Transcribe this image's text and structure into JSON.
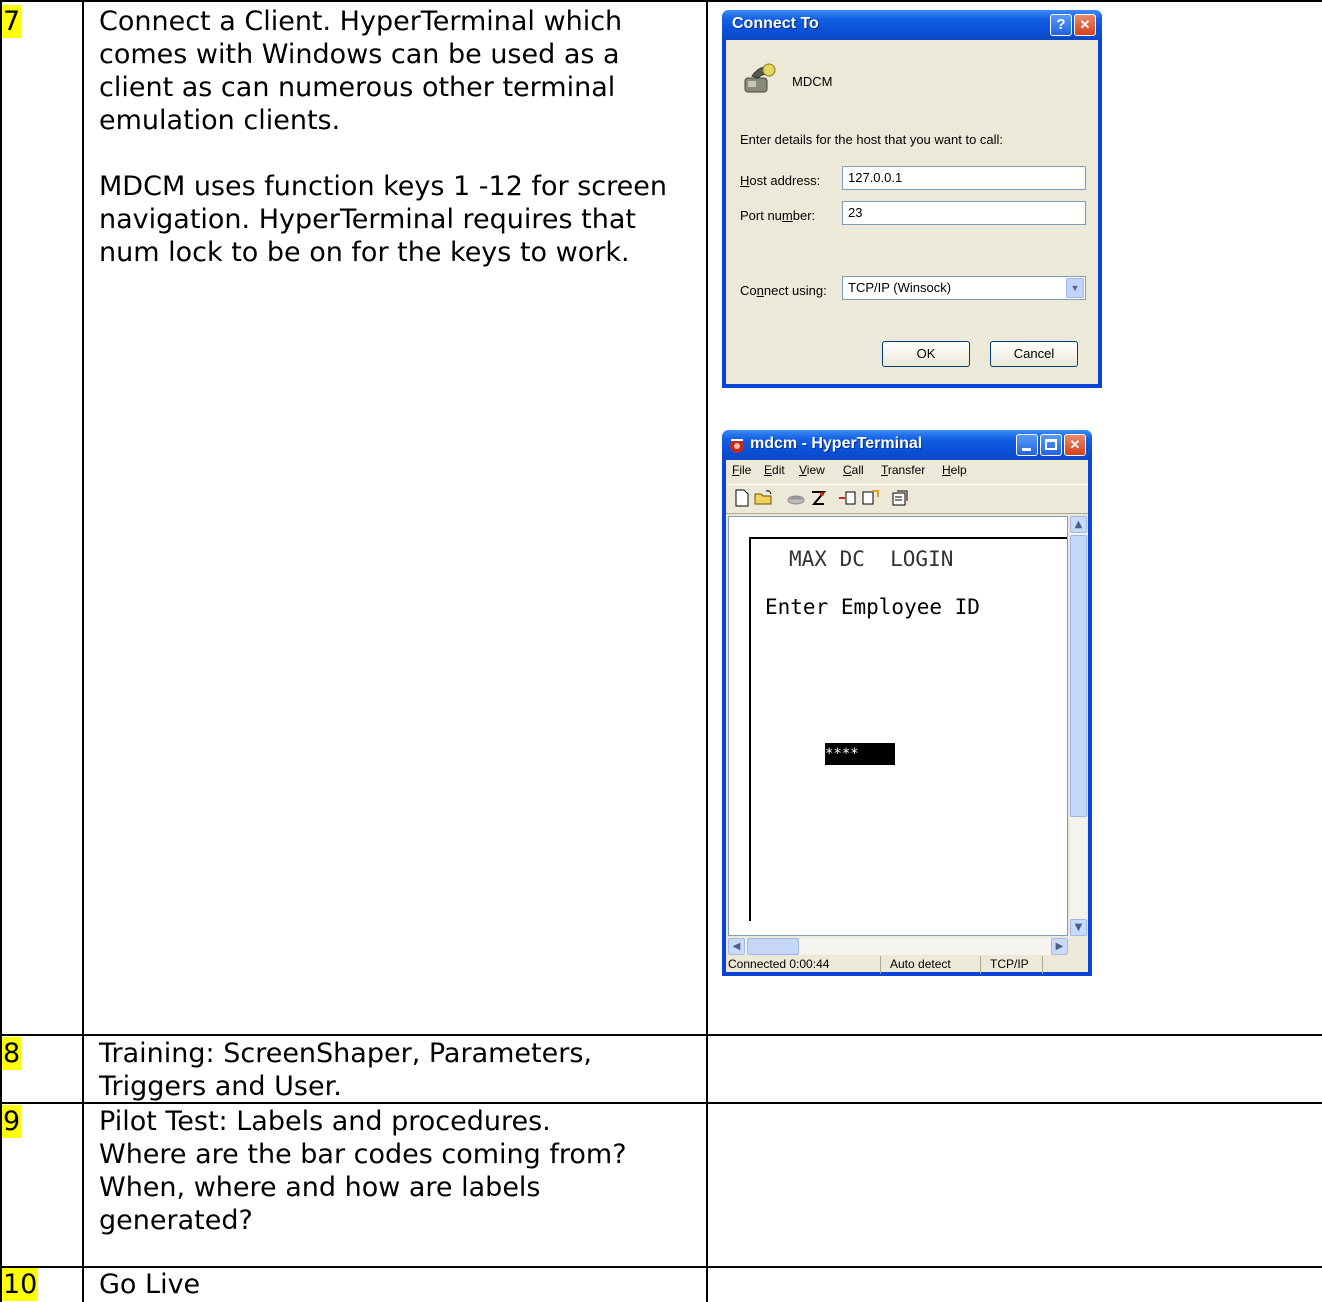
{
  "rows": [
    {
      "step": "7",
      "description": "Connect a Client. HyperTerminal which\ncomes with Windows can be used as a\nclient as can numerous other terminal\nemulation clients.\n\nMDCM uses function keys 1 -12 for screen\nnavigation. HyperTerminal requires that\nnum lock to be on for the keys to work."
    },
    {
      "step": "8",
      "description": "Training: ScreenShaper, Parameters,\nTriggers and User."
    },
    {
      "step": "9",
      "description": "Pilot Test: Labels and procedures.\nWhere are the bar codes coming from?\nWhen, where and how are labels\ngenerated?"
    },
    {
      "step": "10",
      "description": "Go Live"
    }
  ],
  "connect_dialog": {
    "title": "Connect To",
    "help_glyph": "?",
    "close_glyph": "✕",
    "connection_name": "MDCM",
    "prompt": "Enter details for the host that you want to call:",
    "host_label_key": "H",
    "host_label_rest": "ost address:",
    "host_value": "127.0.0.1",
    "port_label_pre": "Port nu",
    "port_label_key": "m",
    "port_label_post": "ber:",
    "port_value": "23",
    "connect_label_pre": "Co",
    "connect_label_key": "n",
    "connect_label_post": "nect using:",
    "connect_value": "TCP/IP (Winsock)",
    "ok_label": "OK",
    "cancel_label": "Cancel"
  },
  "hyperterminal": {
    "title": "mdcm - HyperTerminal",
    "menu": [
      {
        "key": "F",
        "rest": "ile"
      },
      {
        "key": "E",
        "rest": "dit"
      },
      {
        "key": "V",
        "rest": "iew"
      },
      {
        "key": "C",
        "rest": "all"
      },
      {
        "key": "T",
        "rest": "ransfer"
      },
      {
        "key": "H",
        "rest": "elp"
      }
    ],
    "toolbar_icons": [
      "new-icon",
      "open-icon",
      "disconnect-icon",
      "dial-icon",
      "send-icon",
      "receive-icon",
      "properties-icon"
    ],
    "screen_line_1": "MAX DC  LOGIN",
    "screen_line_2": "Enter Employee ID",
    "masked_input": "****",
    "status_connected": "Connected 0:00:44",
    "status_detect": "Auto detect",
    "status_protocol": "TCP/IP",
    "colors": {
      "titlebar": "#0a50d6",
      "close": "#d4421c",
      "dialog_bg": "#ece9d8"
    }
  }
}
